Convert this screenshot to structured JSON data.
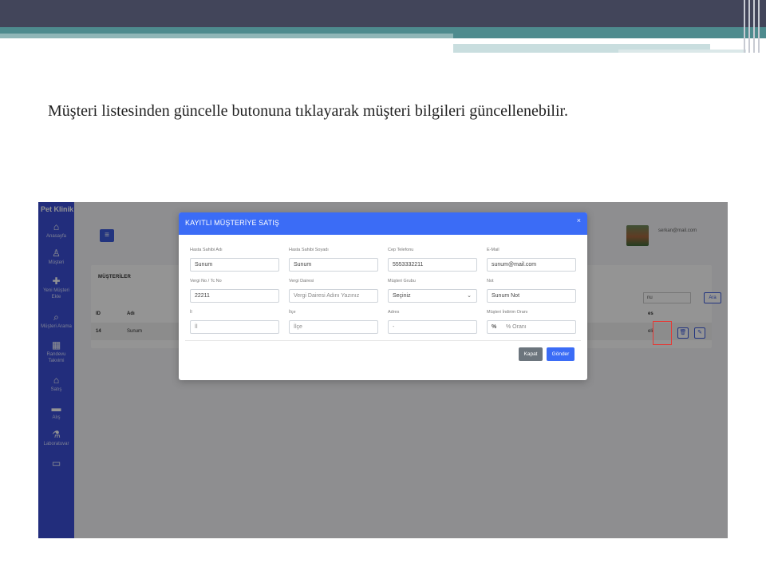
{
  "slide": {
    "caption": "Müşteri listesinden güncelle butonuna tıklayarak müşteri bilgileri güncellenebilir."
  },
  "app": {
    "brand": "Pet Klinik",
    "sidebar": [
      {
        "icon": "home-icon",
        "glyph": "⌂",
        "label": "Anasayfa"
      },
      {
        "icon": "user-icon",
        "glyph": "♙",
        "label": "Müşteri"
      },
      {
        "icon": "user-plus-icon",
        "glyph": "✚",
        "label": "Yeni Müşteri Ekle"
      },
      {
        "icon": "search-icon",
        "glyph": "⌕",
        "label": "Müşteri Arama"
      },
      {
        "icon": "calendar-icon",
        "glyph": "▦",
        "label": "Randevu Takvimi"
      },
      {
        "icon": "basket-icon",
        "glyph": "⌂",
        "label": "Satış"
      },
      {
        "icon": "truck-icon",
        "glyph": "▬",
        "label": "Alış"
      },
      {
        "icon": "flask-icon",
        "glyph": "⚗",
        "label": "Laboratuvar"
      },
      {
        "icon": "money-icon",
        "glyph": "▭",
        "label": ""
      }
    ],
    "user_email": "serkan@mail.com",
    "card_title": "MÜŞTERİLER",
    "table": {
      "headers": [
        "ID",
        "Adı"
      ],
      "row": [
        "14",
        "Sunum"
      ],
      "search_fragment": "nu",
      "search_button": "Ara",
      "right_header_fragment": "es",
      "right_cell_fragment": "eli"
    },
    "accent_color": "#3b6cf6",
    "highlight_color": "#e53935"
  },
  "modal": {
    "title": "KAYITLI MÜŞTERİYE SATIŞ",
    "close": "×",
    "fields": {
      "first_name": {
        "label": "Hasta Sahibi Adı",
        "value": "Sunum"
      },
      "last_name": {
        "label": "Hasta Sahibi Soyadı",
        "value": "Sunum"
      },
      "phone": {
        "label": "Cep Telefonu",
        "value": "5553332211"
      },
      "email": {
        "label": "E-Mail",
        "value": "sunum@mail.com"
      },
      "tax_no": {
        "label": "Vergi No / Tc No",
        "value": "22211"
      },
      "tax_office": {
        "label": "Vergi Dairesi",
        "placeholder": "Vergi Dairesi Adını Yazınız"
      },
      "group": {
        "label": "Müşteri Grubu",
        "value": "Seçiniz"
      },
      "note": {
        "label": "Not",
        "value": "Sunum Not"
      },
      "city": {
        "label": "İl",
        "placeholder": "İl"
      },
      "district": {
        "label": "İlçe",
        "placeholder": "İlçe"
      },
      "address": {
        "label": "Adres",
        "value": "-"
      },
      "discount": {
        "label": "Müşteri İndirim Oranı",
        "prefix": "%",
        "placeholder": "% Oranı"
      }
    },
    "buttons": {
      "close": "Kapat",
      "send": "Gönder"
    }
  }
}
